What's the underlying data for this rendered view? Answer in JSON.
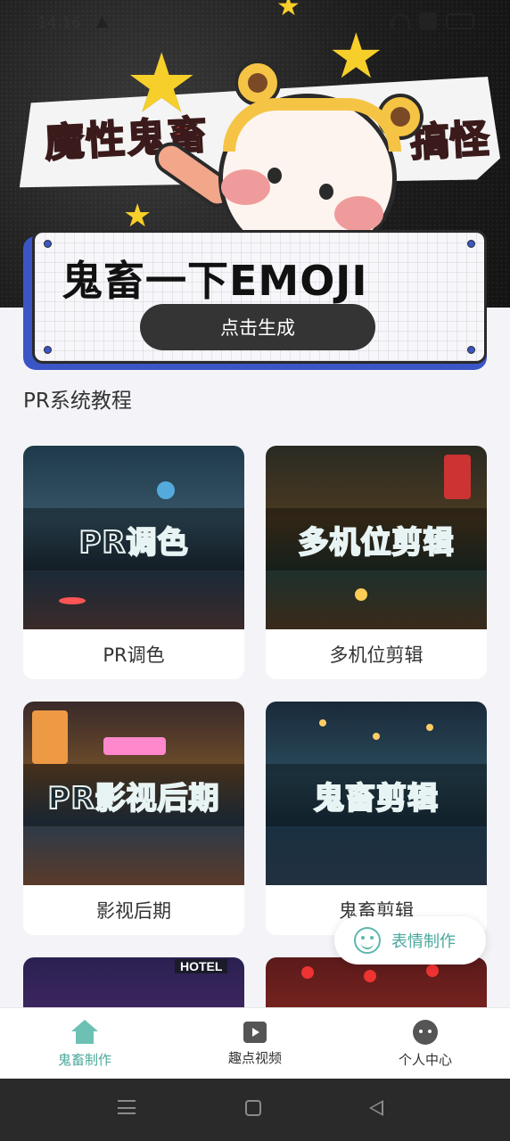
{
  "status_bar": {
    "time": "14:16",
    "warning": "▲"
  },
  "banner": {
    "title_left": "魔性鬼畜",
    "title_right": "搞怪",
    "emoji_title": "鬼畜一下EMOJI",
    "generate_button": "点击生成"
  },
  "section": {
    "title": "PR系统教程"
  },
  "cards": [
    {
      "overlay": "PR调色",
      "label": "PR调色"
    },
    {
      "overlay": "多机位剪辑",
      "label": "多机位剪辑"
    },
    {
      "overlay": "PR影视后期",
      "label": "影视后期"
    },
    {
      "overlay": "鬼畜剪辑",
      "label": "鬼畜剪辑"
    },
    {
      "sign": "HOTEL"
    }
  ],
  "floating_button": {
    "label": "表情制作"
  },
  "tabbar": {
    "tabs": [
      {
        "label": "鬼畜制作",
        "icon": "home-icon",
        "active": true
      },
      {
        "label": "趣点视频",
        "icon": "video-icon",
        "active": false
      },
      {
        "label": "个人中心",
        "icon": "user-icon",
        "active": false
      }
    ],
    "active_color": "#4aa89d"
  }
}
